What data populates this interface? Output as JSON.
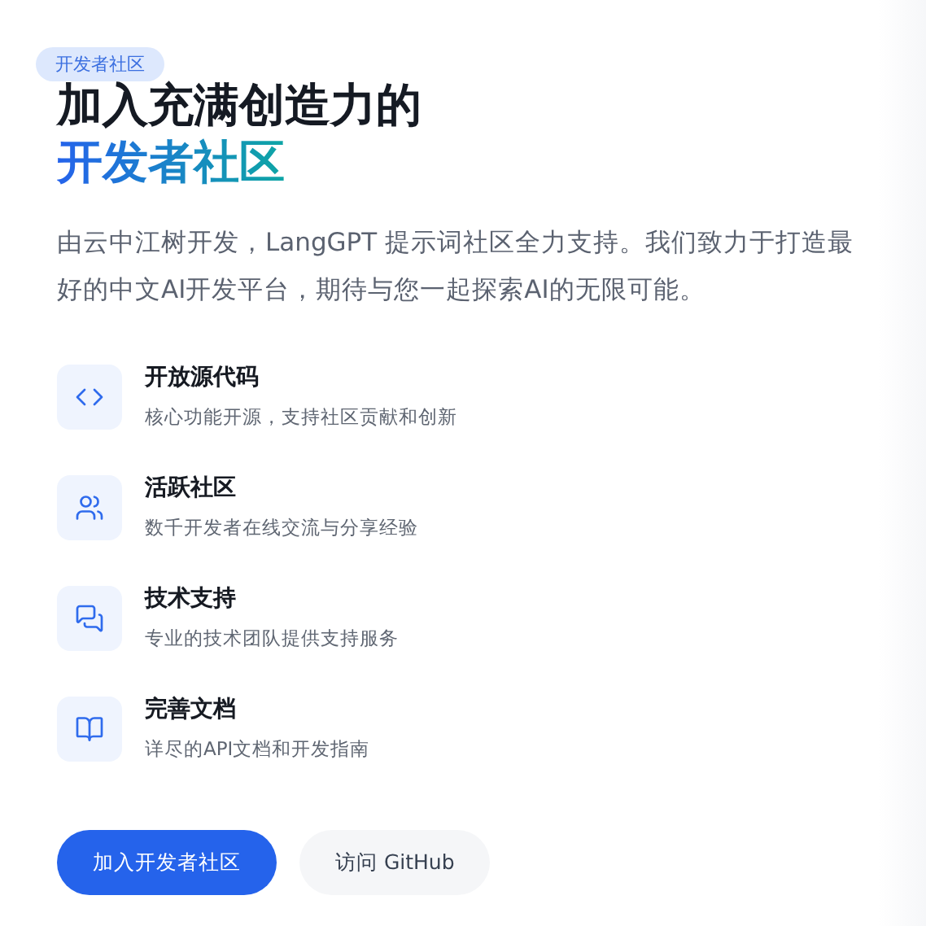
{
  "badge": "开发者社区",
  "title": {
    "line_1": "加入充满创造力的",
    "line_2": "开发者社区"
  },
  "description": "由云中江树开发，LangGPT 提示词社区全力支持。我们致力于打造最好的中文AI开发平台，期待与您一起探索AI的无限可能。",
  "features": [
    {
      "title": "开放源代码",
      "text": "核心功能开源，支持社区贡献和创新"
    },
    {
      "title": "活跃社区",
      "text": "数千开发者在线交流与分享经验"
    },
    {
      "title": "技术支持",
      "text": "专业的技术团队提供支持服务"
    },
    {
      "title": "完善文档",
      "text": "详尽的API文档和开发指南"
    }
  ],
  "buttons": [
    {
      "label": "加入开发者社区",
      "kind": "primary"
    },
    {
      "label": "访问 GitHub",
      "kind": "secondary"
    }
  ]
}
